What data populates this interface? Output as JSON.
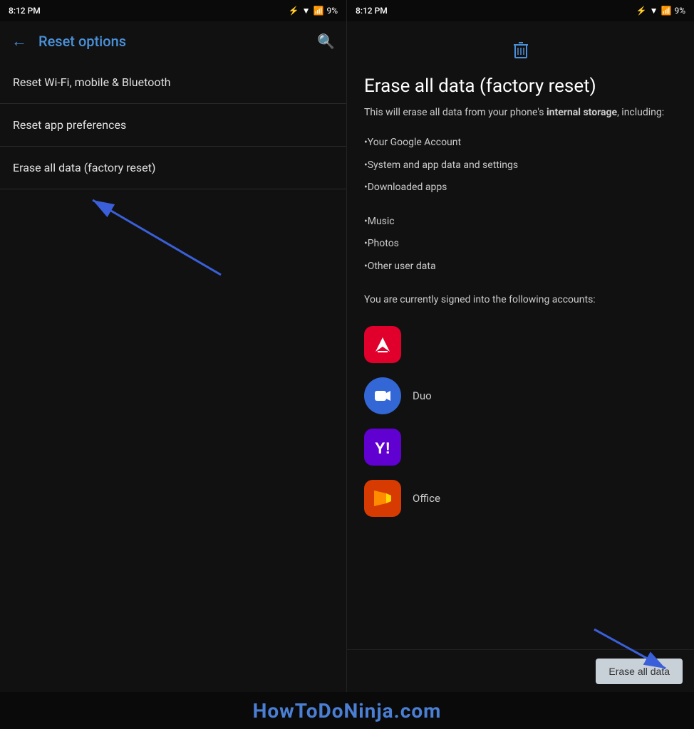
{
  "left": {
    "status": {
      "time": "8:12 PM",
      "battery": "9%"
    },
    "toolbar": {
      "back_label": "←",
      "title": "Reset options",
      "search_label": "🔍"
    },
    "menu_items": [
      {
        "id": "wifi",
        "label": "Reset Wi-Fi, mobile & Bluetooth"
      },
      {
        "id": "app",
        "label": "Reset app preferences"
      },
      {
        "id": "factory",
        "label": "Erase all data (factory reset)"
      }
    ]
  },
  "right": {
    "status": {
      "time": "8:12 PM",
      "battery": "9%"
    },
    "content": {
      "title": "Erase all data (factory reset)",
      "description_prefix": "This will erase all data from your phone's ",
      "description_bold": "internal storage",
      "description_suffix": ", including:",
      "items": [
        "•Your Google Account",
        "•System and app data and settings",
        "•Downloaded apps",
        "•Music",
        "•Photos",
        "•Other user data"
      ],
      "signed_in_text": "You are currently signed into the following accounts:",
      "accounts": [
        {
          "id": "adobe",
          "label": "",
          "color": "adobe"
        },
        {
          "id": "duo",
          "label": "Duo",
          "color": "duo"
        },
        {
          "id": "yahoo",
          "label": "",
          "color": "yahoo"
        },
        {
          "id": "office",
          "label": "Office",
          "color": "office"
        }
      ],
      "erase_button_label": "Erase all data"
    }
  },
  "watermark": "HowToDoNinja.com"
}
